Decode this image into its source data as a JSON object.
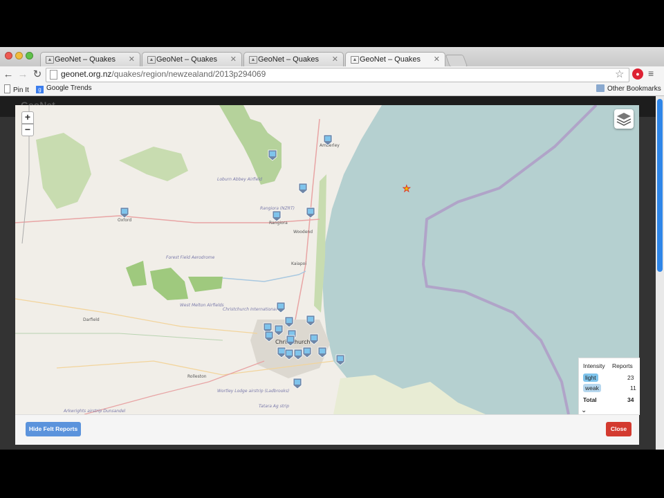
{
  "tabs": [
    {
      "label": "GeoNet – Quakes",
      "active": false
    },
    {
      "label": "GeoNet – Quakes",
      "active": false
    },
    {
      "label": "GeoNet – Quakes",
      "active": false
    },
    {
      "label": "GeoNet – Quakes",
      "active": true
    }
  ],
  "address": {
    "host": "geonet.org.nz",
    "path": "/quakes/region/newzealand/2013p294069"
  },
  "bookmarks": {
    "pin_it": "Pin It",
    "google_trends": "Google Trends",
    "other": "Other Bookmarks"
  },
  "background": {
    "logo": "GeoNet"
  },
  "map": {
    "zoom_in": "+",
    "zoom_out": "−",
    "place_labels": [
      {
        "text": "Amberley"
      },
      {
        "text": "Loburn Abbey Airfield"
      },
      {
        "text": "Rangiora (NZRT)"
      },
      {
        "text": "Rangiora"
      },
      {
        "text": "Woodend"
      },
      {
        "text": "Oxford"
      },
      {
        "text": "Forest Field Aerodrome"
      },
      {
        "text": "Kaiapoi"
      },
      {
        "text": "West Melton Airfields"
      },
      {
        "text": "Christchurch International"
      },
      {
        "text": "Darfield"
      },
      {
        "text": "Christchurch"
      },
      {
        "text": "Rolleston"
      },
      {
        "text": "Wortley Lodge airstrip (Ladbrooks)"
      },
      {
        "text": "Arkwrights airstrip Dunsandel"
      },
      {
        "text": "Tatara Ag strip"
      }
    ],
    "epicentre_icon": "star-icon",
    "report_marker_icon": "felt-report-marker-icon"
  },
  "legend": {
    "header_intensity": "Intensity",
    "header_reports": "Reports",
    "rows": [
      {
        "label": "light",
        "count": "23",
        "color": "#7fc4ec"
      },
      {
        "label": "weak",
        "count": "11",
        "color": "#b6d7ee"
      }
    ],
    "total_label": "Total",
    "total_count": "34"
  },
  "footer": {
    "hide_button": "Hide Felt Reports",
    "close_button": "Close"
  },
  "colors": {
    "sea": "#b5d0d0",
    "land": "#f1eee8",
    "park": "#b5d29b",
    "boundary": "#b0a4c8",
    "accent_blue": "#5b93dc",
    "close_red": "#d33a2f"
  }
}
